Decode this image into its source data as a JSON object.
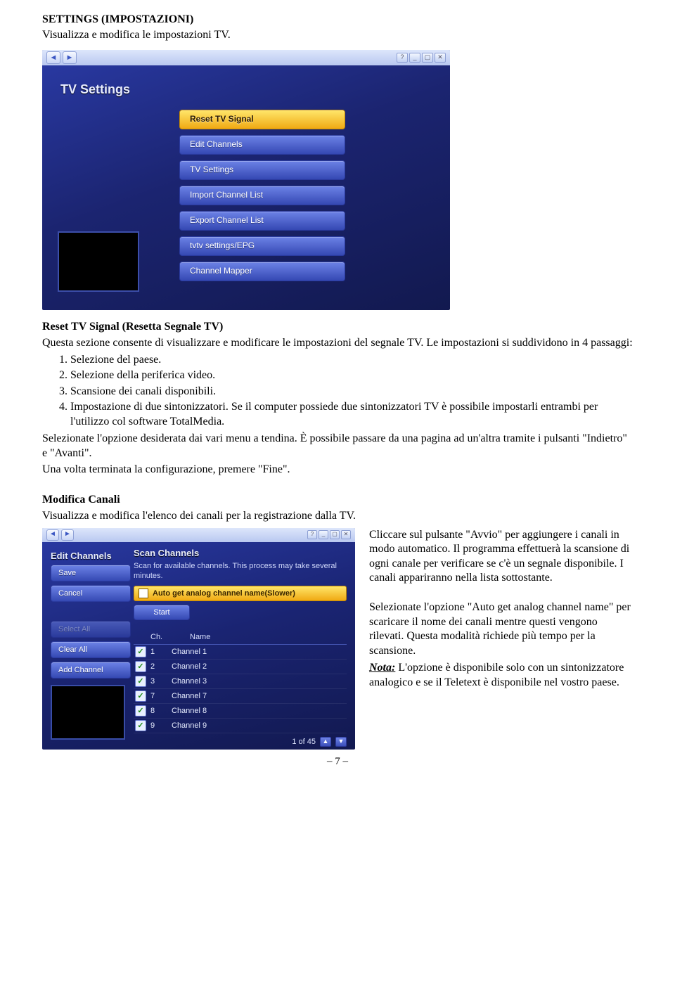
{
  "doc": {
    "h1": "SETTINGS (IMPOSTAZIONI)",
    "h1_sub": "Visualizza e modifica le impostazioni TV.",
    "reset_title": "Reset TV Signal (Resetta Segnale TV)",
    "reset_p1": "Questa sezione consente di visualizzare e modificare le impostazioni del segnale TV. Le impostazioni si suddividono in 4 passaggi:",
    "step1": "Selezione del paese.",
    "step2": "Selezione della periferica video.",
    "step3": "Scansione dei canali disponibili.",
    "step4": "Impostazione di due sintonizzatori. Se il computer possiede due sintonizzatori TV è possibile impostarli entrambi per l'utilizzo col software TotalMedia.",
    "reset_p2": "Selezionate l'opzione desiderata dai vari menu a tendina. È possibile passare da una pagina ad un'altra tramite i pulsanti \"Indietro\" e \"Avanti\".",
    "reset_p3": "Una volta terminata la configurazione, premere \"Fine\".",
    "mod_title": "Modifica Canali",
    "mod_sub": "Visualizza e modifica l'elenco dei canali per la registrazione dalla TV.",
    "mod_r1": "Cliccare sul pulsante \"Avvio\" per aggiungere i canali in modo automatico. Il programma effettuerà la scansione di ogni canale per verificare se c'è un segnale disponibile. I canali appariranno nella lista sottostante.",
    "mod_r2a": "Selezionate l'opzione \"Auto get analog channel name\" per scaricare il nome dei canali mentre questi vengono rilevati. Questa modalità richiede più tempo per la scansione.",
    "mod_nota_label": "Nota:",
    "mod_r2b": " L'opzione è disponibile solo con un sintonizzatore analogico e se il Teletext è disponibile nel vostro paese.",
    "page_num": "– 7 –"
  },
  "shot1": {
    "heading": "TV Settings",
    "items": [
      "Reset TV Signal",
      "Edit Channels",
      "TV Settings",
      "Import Channel List",
      "Export Channel List",
      "tvtv settings/EPG",
      "Channel Mapper"
    ]
  },
  "shot2": {
    "side_title": "Edit Channels",
    "side_buttons": {
      "save": "Save",
      "cancel": "Cancel",
      "select_all": "Select All",
      "clear_all": "Clear All",
      "add_channel": "Add Channel"
    },
    "panel_heading": "Scan Channels",
    "panel_desc": "Scan for available channels. This process may take several minutes.",
    "auto_label": "Auto get analog channel name(Slower)",
    "start": "Start",
    "col_ch": "Ch.",
    "col_name": "Name",
    "rows": [
      {
        "n": "1",
        "name": "Channel 1"
      },
      {
        "n": "2",
        "name": "Channel 2"
      },
      {
        "n": "3",
        "name": "Channel 3"
      },
      {
        "n": "7",
        "name": "Channel 7"
      },
      {
        "n": "8",
        "name": "Channel 8"
      },
      {
        "n": "9",
        "name": "Channel 9"
      }
    ],
    "pager": "1 of 45"
  }
}
